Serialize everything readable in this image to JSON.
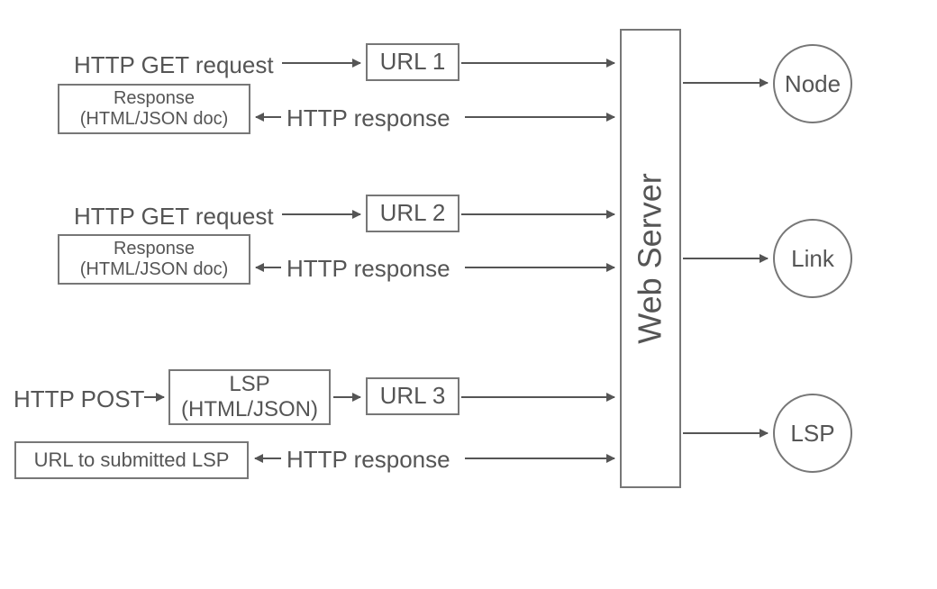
{
  "labels": {
    "get1": "HTTP GET request",
    "get2": "HTTP GET request",
    "post": "HTTP POST",
    "resp1": "HTTP response",
    "resp2": "HTTP response",
    "resp3": "HTTP response",
    "respbox_l1": "Response",
    "respbox_l2": "(HTML/JSON doc)",
    "lspbox_l1": "LSP",
    "lspbox_l2": "(HTML/JSON)",
    "url1": "URL 1",
    "url2": "URL 2",
    "url3": "URL 3",
    "submitted": "URL to submitted LSP",
    "server": "Web Server",
    "node": "Node",
    "link": "Link",
    "lsp": "LSP"
  }
}
